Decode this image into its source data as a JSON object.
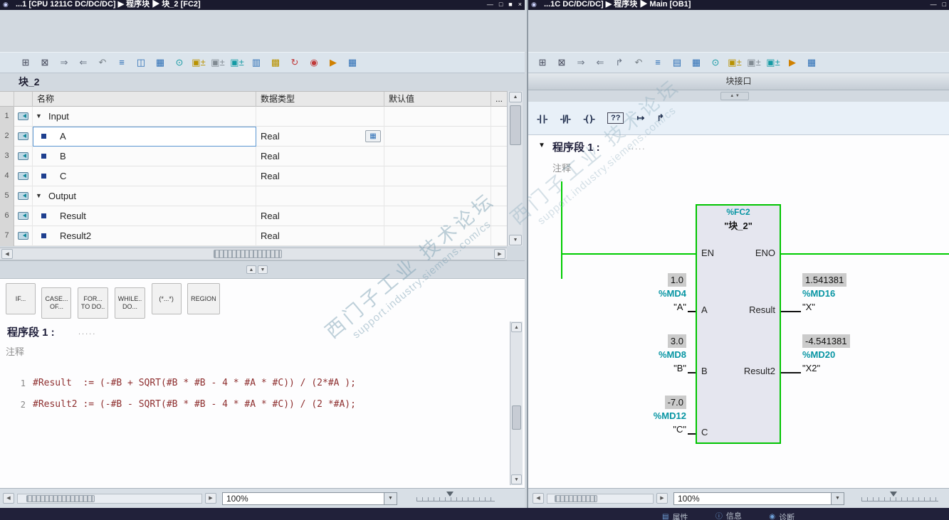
{
  "icons": {
    "app": "◉",
    "expander": "▼",
    "up": "▲",
    "down": "▼",
    "left": "◀",
    "right": "▶",
    "browse": "▦"
  },
  "watermark": {
    "line1": "西门子工业 技术论坛",
    "line2": "support.industry.siemens.com/cs"
  },
  "left": {
    "titlebar": {
      "title": "...1 [CPU 1211C DC/DC/DC] ▶ 程序块 ▶ 块_2 [FC2]",
      "controls": [
        "—",
        "□",
        "■",
        "×"
      ]
    },
    "toolbar": [
      {
        "name": "insert-row-icon",
        "glyph": "⊞",
        "color": "#44485a"
      },
      {
        "name": "delete-row-icon",
        "glyph": "⊠",
        "color": "#44485a"
      },
      {
        "name": "keep-values-icon",
        "glyph": "⇒",
        "color": "#667080"
      },
      {
        "name": "reset-values-icon",
        "glyph": "⇐",
        "color": "#667080"
      },
      {
        "name": "undo-icon",
        "glyph": "↶",
        "color": "#778088"
      },
      {
        "name": "network-list-icon",
        "glyph": "≡",
        "color": "#2a6db5"
      },
      {
        "name": "split-editor-icon",
        "glyph": "◫",
        "color": "#2a6db5"
      },
      {
        "name": "overview-icon",
        "glyph": "▦",
        "color": "#2a6db5"
      },
      {
        "name": "comment-icon",
        "glyph": "⊙",
        "color": "#149aa4"
      },
      {
        "name": "db-calls-icon",
        "glyph": "▣±",
        "color": "#b89200"
      },
      {
        "name": "db-environment-icon",
        "glyph": "▣±",
        "color": "#808a92"
      },
      {
        "name": "db-instance-icon",
        "glyph": "▣±",
        "color": "#149aa4"
      },
      {
        "name": "absolute-operands-icon",
        "glyph": "▥",
        "color": "#2a6db5"
      },
      {
        "name": "settings-icon",
        "glyph": "▩",
        "color": "#b89200"
      },
      {
        "name": "monitor-refresh-icon",
        "glyph": "↻",
        "color": "#c03a3a"
      },
      {
        "name": "monitor-on-icon",
        "glyph": "◉",
        "color": "#c03a3a"
      },
      {
        "name": "more-commands-icon",
        "glyph": "▶",
        "color": "#d08000"
      },
      {
        "name": "open-table-icon",
        "glyph": "▦",
        "color": "#2a6db5"
      }
    ],
    "block_label": "块_2",
    "table": {
      "headers": {
        "name": "名称",
        "type": "数据类型",
        "default": "默认值",
        "more": "..."
      },
      "rows": [
        {
          "num": "1",
          "name": "Input",
          "type": ""
        },
        {
          "num": "2",
          "name": "A",
          "type": "Real"
        },
        {
          "num": "3",
          "name": "B",
          "type": "Real"
        },
        {
          "num": "4",
          "name": "C",
          "type": "Real"
        },
        {
          "num": "5",
          "name": "Output",
          "type": ""
        },
        {
          "num": "6",
          "name": "Result",
          "type": "Real"
        },
        {
          "num": "7",
          "name": "Result2",
          "type": "Real"
        }
      ]
    },
    "scl_tabs": [
      {
        "name": "snippet-if",
        "label": "IF..."
      },
      {
        "name": "snippet-case",
        "label": "CASE...\nOF..."
      },
      {
        "name": "snippet-for",
        "label": "FOR...\nTO DO.."
      },
      {
        "name": "snippet-while",
        "label": "WHILE..\nDO..."
      },
      {
        "name": "snippet-comment",
        "label": "(*...*)"
      },
      {
        "name": "snippet-region",
        "label": "REGION"
      }
    ],
    "network": {
      "title": "程序段 1 :",
      "dots": ".....",
      "comment": "注释"
    },
    "code": {
      "lines": [
        {
          "num": "1",
          "text": "#Result  := (-#B + SQRT(#B * #B - 4 * #A * #C)) / (2*#A );"
        },
        {
          "num": "2",
          "text": "#Result2 := (-#B - SQRT(#B * #B - 4 * #A * #C)) / (2 *#A);"
        }
      ]
    },
    "statusbar": {
      "zoom": "100%"
    }
  },
  "right": {
    "titlebar": {
      "title": "...1C DC/DC/DC] ▶ 程序块 ▶ Main [OB1]",
      "controls": [
        "—",
        "□"
      ]
    },
    "toolbar": [
      {
        "name": "insert-network-icon",
        "glyph": "⊞",
        "color": "#44485a"
      },
      {
        "name": "delete-network-icon",
        "glyph": "⊠",
        "color": "#44485a"
      },
      {
        "name": "goto-next-icon",
        "glyph": "⇒",
        "color": "#667080"
      },
      {
        "name": "goto-previous-icon",
        "glyph": "⇐",
        "color": "#667080"
      },
      {
        "name": "branch-icon",
        "glyph": "↱",
        "color": "#667080"
      },
      {
        "name": "undo-icon",
        "glyph": "↶",
        "color": "#778088"
      },
      {
        "name": "network-list-icon",
        "glyph": "≡",
        "color": "#2a6db5"
      },
      {
        "name": "lad-view-icon",
        "glyph": "▤",
        "color": "#2a6db5"
      },
      {
        "name": "overview-icon",
        "glyph": "▦",
        "color": "#2a6db5"
      },
      {
        "name": "comment-icon",
        "glyph": "⊙",
        "color": "#149aa4"
      },
      {
        "name": "db-calls-icon",
        "glyph": "▣±",
        "color": "#b89200"
      },
      {
        "name": "db-environment-icon",
        "glyph": "▣±",
        "color": "#808a92"
      },
      {
        "name": "db-instance-icon",
        "glyph": "▣±",
        "color": "#149aa4"
      },
      {
        "name": "more-commands-icon",
        "glyph": "▶",
        "color": "#d08000"
      },
      {
        "name": "open-table-icon",
        "glyph": "▦",
        "color": "#2a6db5"
      }
    ],
    "interface_label": "块接口",
    "favorites": [
      {
        "name": "contact-no-icon",
        "glyph": "-| |-",
        "cls": "fav"
      },
      {
        "name": "contact-nc-icon",
        "glyph": "-|/|-",
        "cls": "fav"
      },
      {
        "name": "coil-icon",
        "glyph": "-( )-",
        "cls": "fav"
      },
      {
        "name": "empty-box-icon",
        "glyph": "??",
        "cls": "fav fav-box"
      },
      {
        "name": "open-branch-icon",
        "glyph": "↦",
        "cls": "fav"
      },
      {
        "name": "close-branch-icon",
        "glyph": "↱",
        "cls": "fav"
      }
    ],
    "network": {
      "title": "程序段 1 :",
      "dots": ".....",
      "comment": "注释"
    },
    "lad": {
      "block": {
        "fc": "%FC2",
        "name": "\"块_2\"",
        "en": "EN",
        "eno": "ENO",
        "pins_left": [
          "A",
          "B",
          "C"
        ],
        "pins_right": [
          "Result",
          "Result2"
        ]
      },
      "inputs": [
        {
          "value": "1.0",
          "address": "%MD4",
          "tag": "\"A\""
        },
        {
          "value": "3.0",
          "address": "%MD8",
          "tag": "\"B\""
        },
        {
          "value": "-7.0",
          "address": "%MD12",
          "tag": "\"C\""
        }
      ],
      "outputs": [
        {
          "value": "1.541381",
          "address": "%MD16",
          "tag": "\"X\""
        },
        {
          "value": "-4.541381",
          "address": "%MD20",
          "tag": "\"X2\""
        }
      ]
    },
    "statusbar": {
      "zoom": "100%"
    }
  },
  "inspector_tabs": [
    {
      "name": "tab-properties",
      "icon": "▤",
      "label": "属性"
    },
    {
      "name": "tab-info",
      "icon": "ⓘ",
      "label": "信息"
    },
    {
      "name": "tab-diagnostics",
      "icon": "◉",
      "label": "诊断"
    }
  ]
}
